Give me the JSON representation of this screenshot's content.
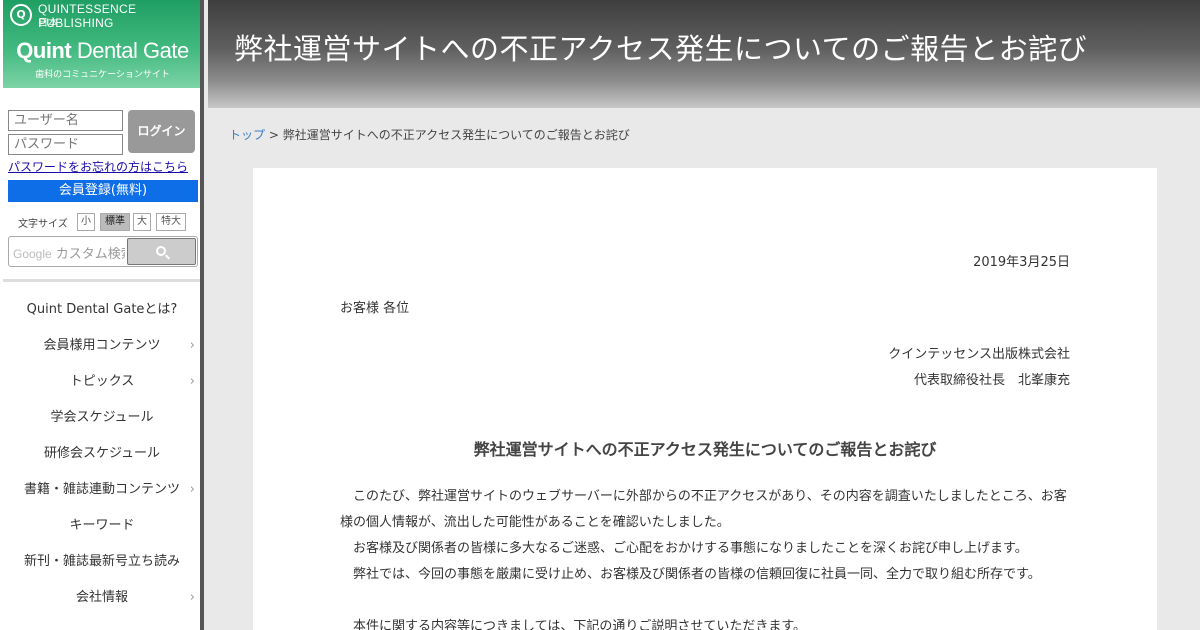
{
  "sidebar": {
    "logo": {
      "publisher": "QUINTESSENCE PUBLISHING",
      "publisher_jp": "日本",
      "brand_bold": "Quint",
      "brand_rest": " Dental Gate",
      "tagline": "歯科のコミュニケーションサイト"
    },
    "login": {
      "username_placeholder": "ユーザー名",
      "password_placeholder": "パスワード",
      "button_label": "ログイン",
      "forgot_link": "パスワードをお忘れの方はこちら",
      "register_label": "会員登録(無料)"
    },
    "font_size": {
      "label": "文字サイズ",
      "options": [
        "小",
        "標準",
        "大",
        "特大"
      ],
      "selected": "標準"
    },
    "search": {
      "brand": "Google",
      "placeholder": "カスタム検索"
    },
    "nav": [
      {
        "label": "Quint Dental Gateとは?",
        "has_submenu": false
      },
      {
        "label": "会員様用コンテンツ",
        "has_submenu": true
      },
      {
        "label": "トピックス",
        "has_submenu": true
      },
      {
        "label": "学会スケジュール",
        "has_submenu": false
      },
      {
        "label": "研修会スケジュール",
        "has_submenu": false
      },
      {
        "label": "書籍・雑誌連動コンテンツ",
        "has_submenu": true
      },
      {
        "label": "キーワード",
        "has_submenu": false
      },
      {
        "label": "新刊・雑誌最新号立ち読み",
        "has_submenu": false
      },
      {
        "label": "会社情報",
        "has_submenu": true
      }
    ]
  },
  "header": {
    "title": "弊社運営サイトへの不正アクセス発生についてのご報告とお詫び"
  },
  "breadcrumb": {
    "home": "トップ",
    "separator": " > ",
    "current": "弊社運営サイトへの不正アクセス発生についてのご報告とお詫び"
  },
  "article": {
    "date": "2019年3月25日",
    "greeting": "お客様 各位",
    "company": "クインテッセンス出版株式会社",
    "representative": "代表取締役社長　北峯康充",
    "title": "弊社運営サイトへの不正アクセス発生についてのご報告とお詫び",
    "paragraphs": [
      "このたび、弊社運営サイトのウェブサーバーに外部からの不正アクセスがあり、その内容を調査いたしましたところ、お客様の個人情報が、流出した可能性があることを確認いたしました。",
      "お客様及び関係者の皆様に多大なるご迷惑、ご心配をおかけする事態になりましたことを深くお詫び申し上げます。",
      "弊社では、今回の事態を厳粛に受け止め、お客様及び関係者の皆様の信頼回復に社員一同、全力で取り組む所存です。",
      "本件に関する内容等につきましては、下記の通りご説明させていただきます。"
    ]
  },
  "colors": {
    "logo_green": "#2fae6f",
    "register_blue": "#0e6ee8",
    "link_blue": "#3a7cc4",
    "header_gray": "#4a4a4a"
  }
}
